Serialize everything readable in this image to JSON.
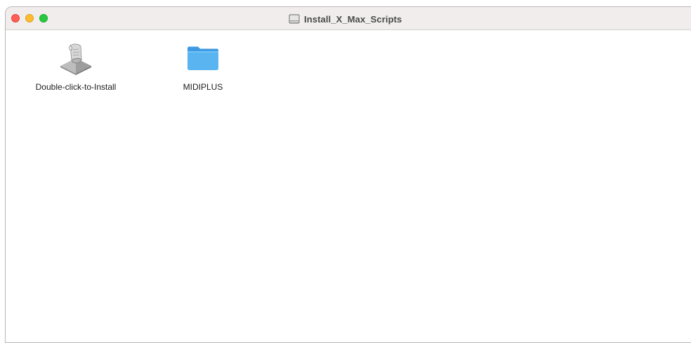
{
  "window": {
    "title": "Install_X_Max_Scripts"
  },
  "icons": {
    "title_icon": "disk-image-icon",
    "app_icon": "script-installer-icon",
    "folder_icon": "folder-icon"
  },
  "files": [
    {
      "name": "Double-click-to-Install",
      "kind": "script"
    },
    {
      "name": "MIDIPLUS",
      "kind": "folder"
    }
  ],
  "colors": {
    "close": "#ff5f57",
    "minimize": "#febc2e",
    "zoom": "#28c840",
    "folder": "#5ab4f0"
  }
}
